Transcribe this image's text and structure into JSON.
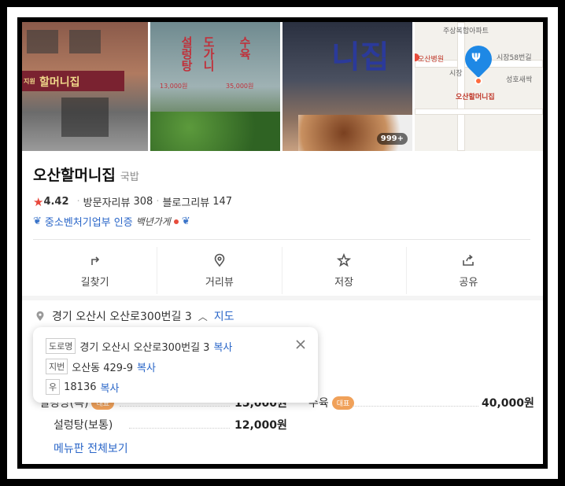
{
  "place": {
    "name": "오산할머니집",
    "category": "국밥",
    "rating": "4.42",
    "visitor_reviews_label": "방문자리뷰",
    "visitor_reviews_count": "308",
    "blog_reviews_label": "블로그리뷰",
    "blog_reviews_count": "147",
    "cert_text": "중소벤처기업부 인증",
    "cert_brand": "백년가게"
  },
  "photos": {
    "shop_sign": "할머니집",
    "shop_sign_prefix": "지원",
    "glass_left": "설렁탕",
    "glass_mid": "도가니",
    "glass_right": "수육",
    "price_left": "13,000원",
    "price_right": "35,000원",
    "big_chars": "니집",
    "more_count": "999+",
    "map": {
      "apt": "주상복합아파트",
      "hospital": "오산병원",
      "street": "시장58번길",
      "area": "시장",
      "area2": "성호새싹",
      "place_label": "오산할머니집"
    }
  },
  "actions": [
    {
      "label": "길찾기",
      "icon": "directions-icon"
    },
    {
      "label": "거리뷰",
      "icon": "location-pin-icon"
    },
    {
      "label": "저장",
      "icon": "star-icon"
    },
    {
      "label": "공유",
      "icon": "share-icon"
    }
  ],
  "address": {
    "main": "경기 오산시 오산로300번길 3",
    "map_link": "지도"
  },
  "popup": {
    "road_tag": "도로명",
    "road_value": "경기 오산시 오산로300번길 3",
    "jibun_tag": "지번",
    "jibun_value": "오산동 429-9",
    "zip_tag": "우",
    "zip_value": "18136",
    "copy_label": "복사"
  },
  "menu": {
    "items": [
      {
        "name": "설렁탕(특)",
        "tag": "대표",
        "price": "15,000원"
      },
      {
        "name": "수육",
        "tag": "대표",
        "price": "40,000원"
      },
      {
        "name": "설렁탕(보통)",
        "price": "12,000원"
      }
    ],
    "more_label": "메뉴판 전체보기"
  }
}
